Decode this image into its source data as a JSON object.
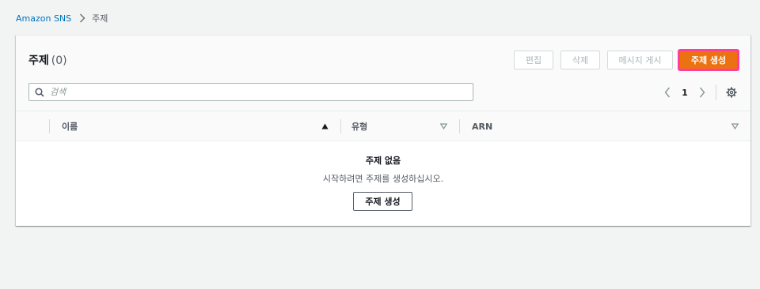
{
  "breadcrumb": {
    "root": "Amazon SNS",
    "current": "주제"
  },
  "panel": {
    "title": "주제",
    "count": "(0)"
  },
  "actions": {
    "edit": "편집",
    "delete": "삭제",
    "publish": "메시지 게시",
    "create": "주제 생성"
  },
  "search": {
    "placeholder": "검색",
    "value": ""
  },
  "pagination": {
    "current_page": "1"
  },
  "table": {
    "columns": [
      {
        "label": "이름",
        "sort": "ascending"
      },
      {
        "label": "유형",
        "sort": "none"
      },
      {
        "label": "ARN",
        "sort": "none"
      }
    ]
  },
  "empty_state": {
    "title": "주제 없음",
    "description": "시작하려면 주제를 생성하십시오.",
    "button": "주제 생성"
  },
  "colors": {
    "primary_button": "#ec7211",
    "link": "#0073bb",
    "highlight_outline": "#ff3d9a"
  },
  "icons": {
    "breadcrumb_separator": "chevron-right-icon",
    "search": "search-icon",
    "prev_page": "chevron-left-icon",
    "next_page": "chevron-right-icon",
    "settings": "gear-icon",
    "sort_ascending": "sort-up-filled-icon",
    "sort_none": "sort-down-outline-icon"
  }
}
